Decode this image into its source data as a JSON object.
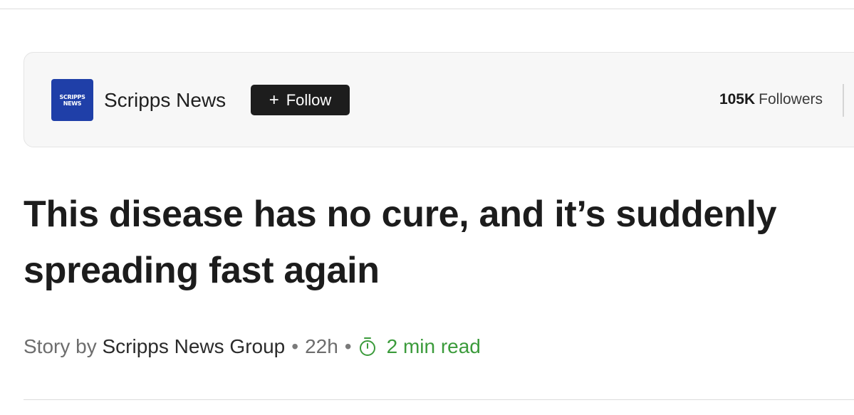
{
  "publisher": {
    "logo_line1": "SCRIPPS",
    "logo_line2": "NEWS",
    "name": "Scripps News",
    "follow_plus": "+",
    "follow_label": "Follow",
    "followers_count": "105K",
    "followers_label": "Followers"
  },
  "article": {
    "headline": "This disease has no cure, and it’s suddenly spreading fast again",
    "byline_prefix": "Story by",
    "author": "Scripps News Group",
    "separator": "•",
    "age": "22h",
    "read_time": "2 min read",
    "read_icon": "timer-icon"
  },
  "colors": {
    "logo_bg": "#1f3fa8",
    "follow_bg": "#1d1d1d",
    "read_time": "#3b9b3b"
  }
}
